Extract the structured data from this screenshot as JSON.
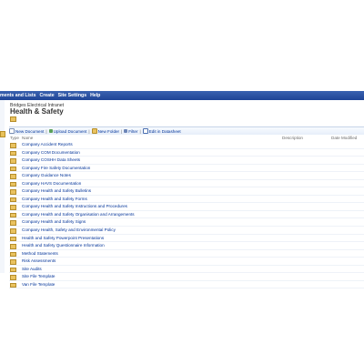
{
  "topnav": {
    "items": [
      "ments and Lists",
      "Create",
      "Site Settings",
      "Help"
    ]
  },
  "site": {
    "name": "Bridges Electrical Intranet",
    "title": "Health & Safety"
  },
  "toolbar": {
    "new_document": "New Document",
    "upload_document": "Upload Document",
    "new_folder": "New Folder",
    "filter": "Filter",
    "edit_in_datasheet": "Edit in Datasheet",
    "separator": "|"
  },
  "columns": {
    "type": "Type",
    "name": "Name",
    "description": "Description",
    "date_modified": "Date Modified"
  },
  "folders": [
    "Company Accident Reports",
    "Company COM Documentation",
    "Company COSHH Data Sheets",
    "Company Fire Safety Documentation",
    "Company Guidance Notes",
    "Company HAVS Documentation",
    "Company Health and Safety Bulletins",
    "Company Health and Safety Forms",
    "Company Health and Safety Instructions and Procedures",
    "Company Health and Safety Organisation and Arrangements",
    "Company Health and Safety Signs",
    "Company Health, Safety and Environmental Policy",
    "Health and Safety Powerpoint Presentations",
    "Health and Safety Questionnaire Information",
    "Method Statements",
    "Risk Assessments",
    "Site Audits",
    "Site File Template",
    "Van File Template"
  ],
  "colors": {
    "topbar": "#2a529f",
    "link": "#003399",
    "folder": "#e9c25f"
  }
}
